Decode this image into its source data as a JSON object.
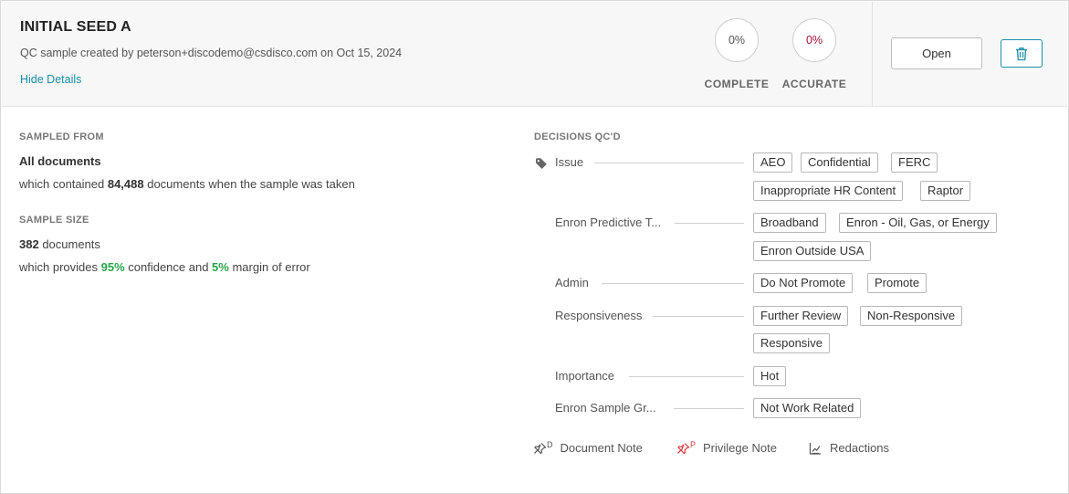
{
  "header": {
    "title": "INITIAL SEED A",
    "subtitle": "QC sample created by peterson+discodemo@csdisco.com on Oct 15, 2024",
    "hide_details": "Hide Details",
    "complete_value": "0%",
    "complete_label": "COMPLETE",
    "accurate_value": "0%",
    "accurate_label": "ACCURATE",
    "open_label": "Open",
    "trash_icon": "trash-icon"
  },
  "sampled_from": {
    "label": "SAMPLED FROM",
    "value": "All documents",
    "detail_prefix": "which contained ",
    "detail_count": "84,488",
    "detail_suffix": " documents when the sample was taken"
  },
  "sample_size": {
    "label": "SAMPLE SIZE",
    "count": "382",
    "count_suffix": " documents",
    "detail_prefix": "which provides ",
    "confidence": "95%",
    "detail_mid": " confidence and ",
    "margin": "5%",
    "detail_suffix": " margin of error"
  },
  "decisions": {
    "label": "DECISIONS QC'D",
    "rows": [
      {
        "name": "Issue",
        "tags": [
          "AEO",
          "Confidential",
          "FERC",
          "Inappropriate HR Content",
          "Raptor"
        ]
      },
      {
        "name": "Enron Predictive T...",
        "tags": [
          "Broadband",
          "Enron - Oil, Gas, or Energy",
          "Enron Outside USA"
        ]
      },
      {
        "name": "Admin",
        "tags": [
          "Do Not Promote",
          "Promote"
        ]
      },
      {
        "name": "Responsiveness",
        "tags": [
          "Further Review",
          "Non-Responsive",
          "Responsive"
        ]
      },
      {
        "name": "Importance",
        "tags": [
          "Hot"
        ]
      },
      {
        "name": "Enron Sample Gr...",
        "tags": [
          "Not Work Related"
        ]
      }
    ]
  },
  "footer": {
    "document_note": "Document Note",
    "document_note_sup": "D",
    "privilege_note": "Privilege Note",
    "privilege_note_sup": "P",
    "redactions": "Redactions",
    "accent_color": "#1a8fa8",
    "privilege_color": "#d9363e"
  }
}
